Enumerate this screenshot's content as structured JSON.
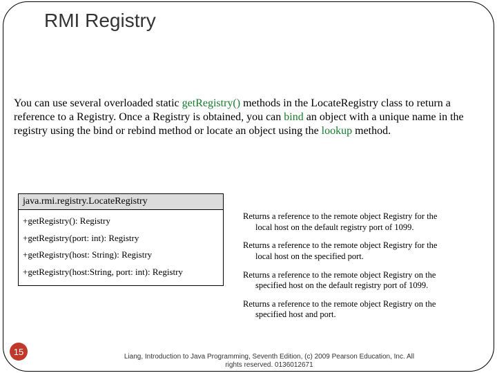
{
  "title": "RMI Registry",
  "paragraph": {
    "p1": "You can use several overloaded static ",
    "kw1": "getRegistry()",
    "p2": " methods in the LocateRegistry class to return a reference to a Registry. Once a Registry is obtained, you can ",
    "kw2": "bind",
    "p3": " an object with a unique name in the registry using the bind or rebind method or locate an object using the ",
    "kw3": "lookup",
    "p4": " method."
  },
  "uml": {
    "class_name": "java.rmi.registry.LocateRegistry",
    "methods": [
      "+getRegistry(): Registry",
      "+getRegistry(port: int): Registry",
      "+getRegistry(host: String): Registry",
      "+getRegistry(host:String, port: int): Registry"
    ]
  },
  "descriptions": [
    {
      "l1": "Returns a reference to the remote object Registry for the",
      "l2": "local host on the default registry port of 1099."
    },
    {
      "l1": "Returns a reference to the remote object Registry for the",
      "l2": "local host on the specified port."
    },
    {
      "l1": "Returns a reference to the remote object Registry on the",
      "l2": "specified host on the default registry port of 1099."
    },
    {
      "l1": "Returns a reference to the remote object Registry on the",
      "l2": "specified host and port."
    }
  ],
  "page_number": "15",
  "footer": {
    "l1": "Liang, Introduction to Java Programming, Seventh Edition, (c) 2009 Pearson Education, Inc. All",
    "l2": "rights reserved. 0136012671"
  },
  "chart_data": {
    "type": "table",
    "title": "java.rmi.registry.LocateRegistry",
    "columns": [
      "method",
      "description"
    ],
    "rows": [
      [
        "+getRegistry(): Registry",
        "Returns a reference to the remote object Registry for the local host on the default registry port of 1099."
      ],
      [
        "+getRegistry(port: int): Registry",
        "Returns a reference to the remote object Registry for the local host on the specified port."
      ],
      [
        "+getRegistry(host: String): Registry",
        "Returns a reference to the remote object Registry on the specified host on the default registry port of 1099."
      ],
      [
        "+getRegistry(host:String, port: int): Registry",
        "Returns a reference to the remote object Registry on the specified host and port."
      ]
    ]
  }
}
